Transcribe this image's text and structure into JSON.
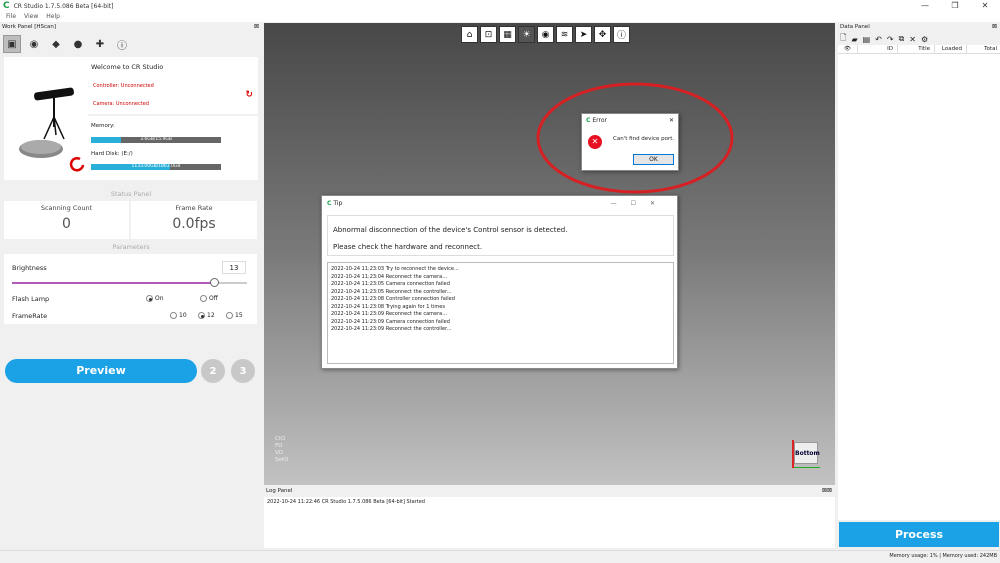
{
  "window": {
    "title": "CR Studio 1.7.5.086 Beta [64-bit]",
    "logo": "C",
    "minimize": "—",
    "restore": "❐",
    "close": "✕"
  },
  "menu": [
    "File",
    "View",
    "Help"
  ],
  "work_panel": {
    "title": "Work Panel [HScan]",
    "close": "⊠",
    "toolbar_icons": [
      "cube-icon",
      "eye-icon",
      "box-icon",
      "sphere-icon",
      "puzzle-icon",
      "info-icon"
    ],
    "welcome": "Welcome to CR Studio",
    "controller_status": "Controller: Unconnected",
    "camera_status": "Camera: Unconnected",
    "memory_label": "Memory:",
    "memory_value": "3.6GB/15.9GB",
    "memory_fraction": 0.23,
    "disk_label": "Hard Disk: (E:/)",
    "disk_value": "1133.00GB/1863.0GB",
    "disk_fraction": 0.61,
    "status_panel": "Status Panel",
    "scanning_count_label": "Scanning Count",
    "scanning_count": "0",
    "frame_rate_label": "Frame Rate",
    "frame_rate": "0.0fps",
    "parameters": "Parameters",
    "brightness_label": "Brightness",
    "brightness": "13",
    "brightness_fraction": 0.86,
    "flash_lamp_label": "Flash Lamp",
    "flash_on": "On",
    "flash_off": "Off",
    "framerate_label": "FrameRate",
    "fr_10": "10",
    "fr_12": "12",
    "fr_15": "15",
    "preview": "Preview",
    "step2": "2",
    "step3": "3"
  },
  "viewport": {
    "overlay": [
      "CtO",
      "FO",
      "VO",
      "SetO"
    ],
    "cube_label": "Bottom"
  },
  "error_dialog": {
    "title": "Error",
    "message": "Can't find device port.",
    "ok": "OK"
  },
  "tip_dialog": {
    "title": "Tip",
    "line1": "Abnormal disconnection of the device's Control sensor is detected.",
    "line2": "Please check the hardware and reconnect.",
    "log": [
      "2022-10-24 11:23:03 Try to reconnect the device...",
      "2022-10-24 11:23:04 Reconnect the camera...",
      "2022-10-24 11:23:05 Camera connection failed",
      "2022-10-24 11:23:05 Reconnect the controller...",
      "2022-10-24 11:23:08 Controller connection failed",
      "2022-10-24 11:23:08 Trying again for  1 times",
      "2022-10-24 11:23:09 Reconnect the camera...",
      "2022-10-24 11:23:09 Camera connection failed",
      "2022-10-24 11:23:09 Reconnect the controller..."
    ]
  },
  "log_panel": {
    "title": "Log Panel",
    "entry": "2022-10-24 11:22:46 CR Studio 1.7.5.086 Beta [64-bit] Started"
  },
  "data_panel": {
    "title": "Data Panel",
    "columns": [
      "👁",
      "ID",
      "Title",
      "Loaded",
      "Total"
    ],
    "process": "Process"
  },
  "status_bar": "Memory usage: 1% | Memory used: 242MB",
  "colors": {
    "accent": "#1aa1e6",
    "error": "#cc0000",
    "highlight_circle": "#d62024"
  }
}
